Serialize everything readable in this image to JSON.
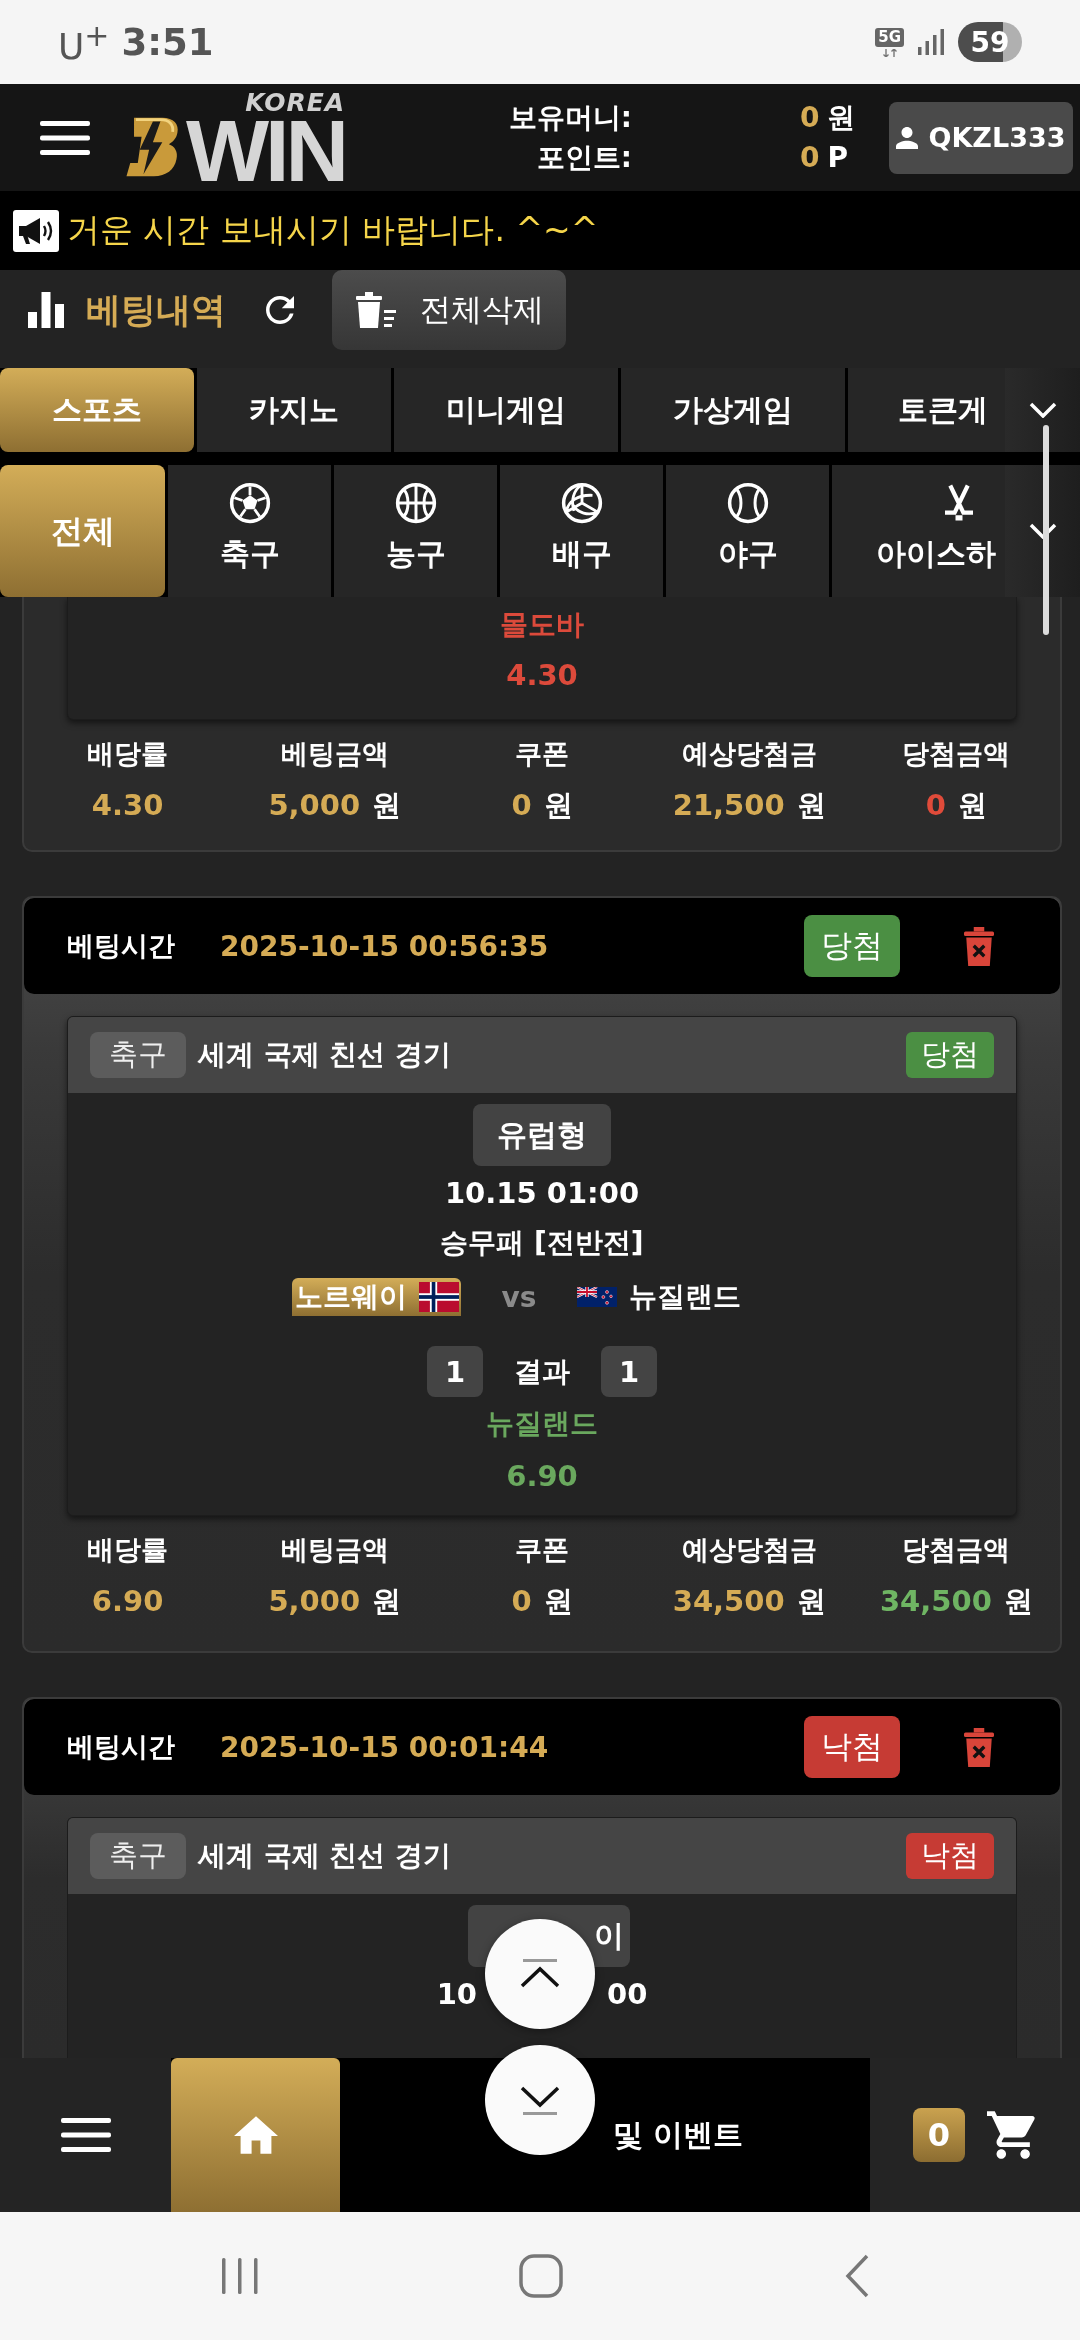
{
  "status_bar": {
    "carrier": "U$^{+}$",
    "time": "3:51",
    "network": "5G",
    "battery": "59"
  },
  "header": {
    "logo_small": "KOREA",
    "logo_large": "WIN",
    "wallet": [
      {
        "label": "보유머니:",
        "value": "0",
        "unit": "원"
      },
      {
        "label": "포인트:",
        "value": "0",
        "unit": "P"
      }
    ],
    "user": "QKZL333"
  },
  "notice": "거운 시간 보내시기 바랍니다. ^~^",
  "toolbar": {
    "title": "베팅내역",
    "delete_all": "전체삭제"
  },
  "category_tabs": [
    {
      "label": "스포츠",
      "selected": true
    },
    {
      "label": "카지노",
      "selected": false
    },
    {
      "label": "미니게임",
      "selected": false
    },
    {
      "label": "가상게임",
      "selected": false
    },
    {
      "label": "토큰게",
      "selected": false
    }
  ],
  "sport_filters": [
    {
      "label": "전체",
      "kind": "all",
      "selected": true
    },
    {
      "label": "축구",
      "kind": "soccer",
      "selected": false
    },
    {
      "label": "농구",
      "kind": "basketball",
      "selected": false
    },
    {
      "label": "배구",
      "kind": "volleyball",
      "selected": false
    },
    {
      "label": "야구",
      "kind": "baseball",
      "selected": false
    },
    {
      "label": "아이스하",
      "kind": "hockey",
      "selected": false
    }
  ],
  "bets": [
    {
      "won": false,
      "match": {
        "pick": "몰도바",
        "pick_odds": "4.30"
      },
      "summary": [
        {
          "kind": "odds",
          "label": "배당률",
          "value": "4.30"
        },
        {
          "kind": "stake",
          "label": "베팅금액",
          "value": "5,000",
          "unit": "원"
        },
        {
          "kind": "coupon",
          "label": "쿠폰",
          "value": "0",
          "unit": "원"
        },
        {
          "kind": "expected",
          "label": "예상당첨금",
          "value": "21,500",
          "unit": "원"
        },
        {
          "kind": "payout",
          "label": "당첨금액",
          "value": "0",
          "unit": "원"
        }
      ]
    },
    {
      "won": true,
      "header": {
        "label": "베팅시간",
        "time": "2025-10-15 00:56:35",
        "badge": "당첨"
      },
      "match": {
        "sport": "축구",
        "league": "세계 국제 친선 경기",
        "badge": "당첨",
        "market": "유럽형",
        "kickoff": "10.15 01:00",
        "bet_type": "승무패 [전반전]",
        "teams": [
          {
            "name": "노르웨이",
            "kind": "norway"
          },
          {
            "name": "뉴질랜드",
            "kind": "new-zealand"
          }
        ],
        "vs": "vs",
        "home_score": "1",
        "result_label": "결과",
        "away_score": "1",
        "pick": "뉴질랜드",
        "pick_odds": "6.90"
      },
      "summary": [
        {
          "kind": "odds",
          "label": "배당률",
          "value": "6.90"
        },
        {
          "kind": "stake",
          "label": "베팅금액",
          "value": "5,000",
          "unit": "원"
        },
        {
          "kind": "coupon",
          "label": "쿠폰",
          "value": "0",
          "unit": "원"
        },
        {
          "kind": "expected",
          "label": "예상당첨금",
          "value": "34,500",
          "unit": "원"
        },
        {
          "kind": "payout",
          "label": "당첨금액",
          "value": "34,500",
          "unit": "원"
        }
      ]
    },
    {
      "won": false,
      "header": {
        "label": "베팅시간",
        "time": "2025-10-15 00:01:44",
        "badge": "낙첨"
      },
      "match": {
        "sport": "축구",
        "league": "세계 국제 친선 경기",
        "badge": "낙첨",
        "market_tail": "이",
        "kickoff_head": "10",
        "kickoff_tail": "00"
      }
    }
  ],
  "bottom_nav": {
    "notice_tail": "및 이벤트",
    "cart_count": "0"
  }
}
